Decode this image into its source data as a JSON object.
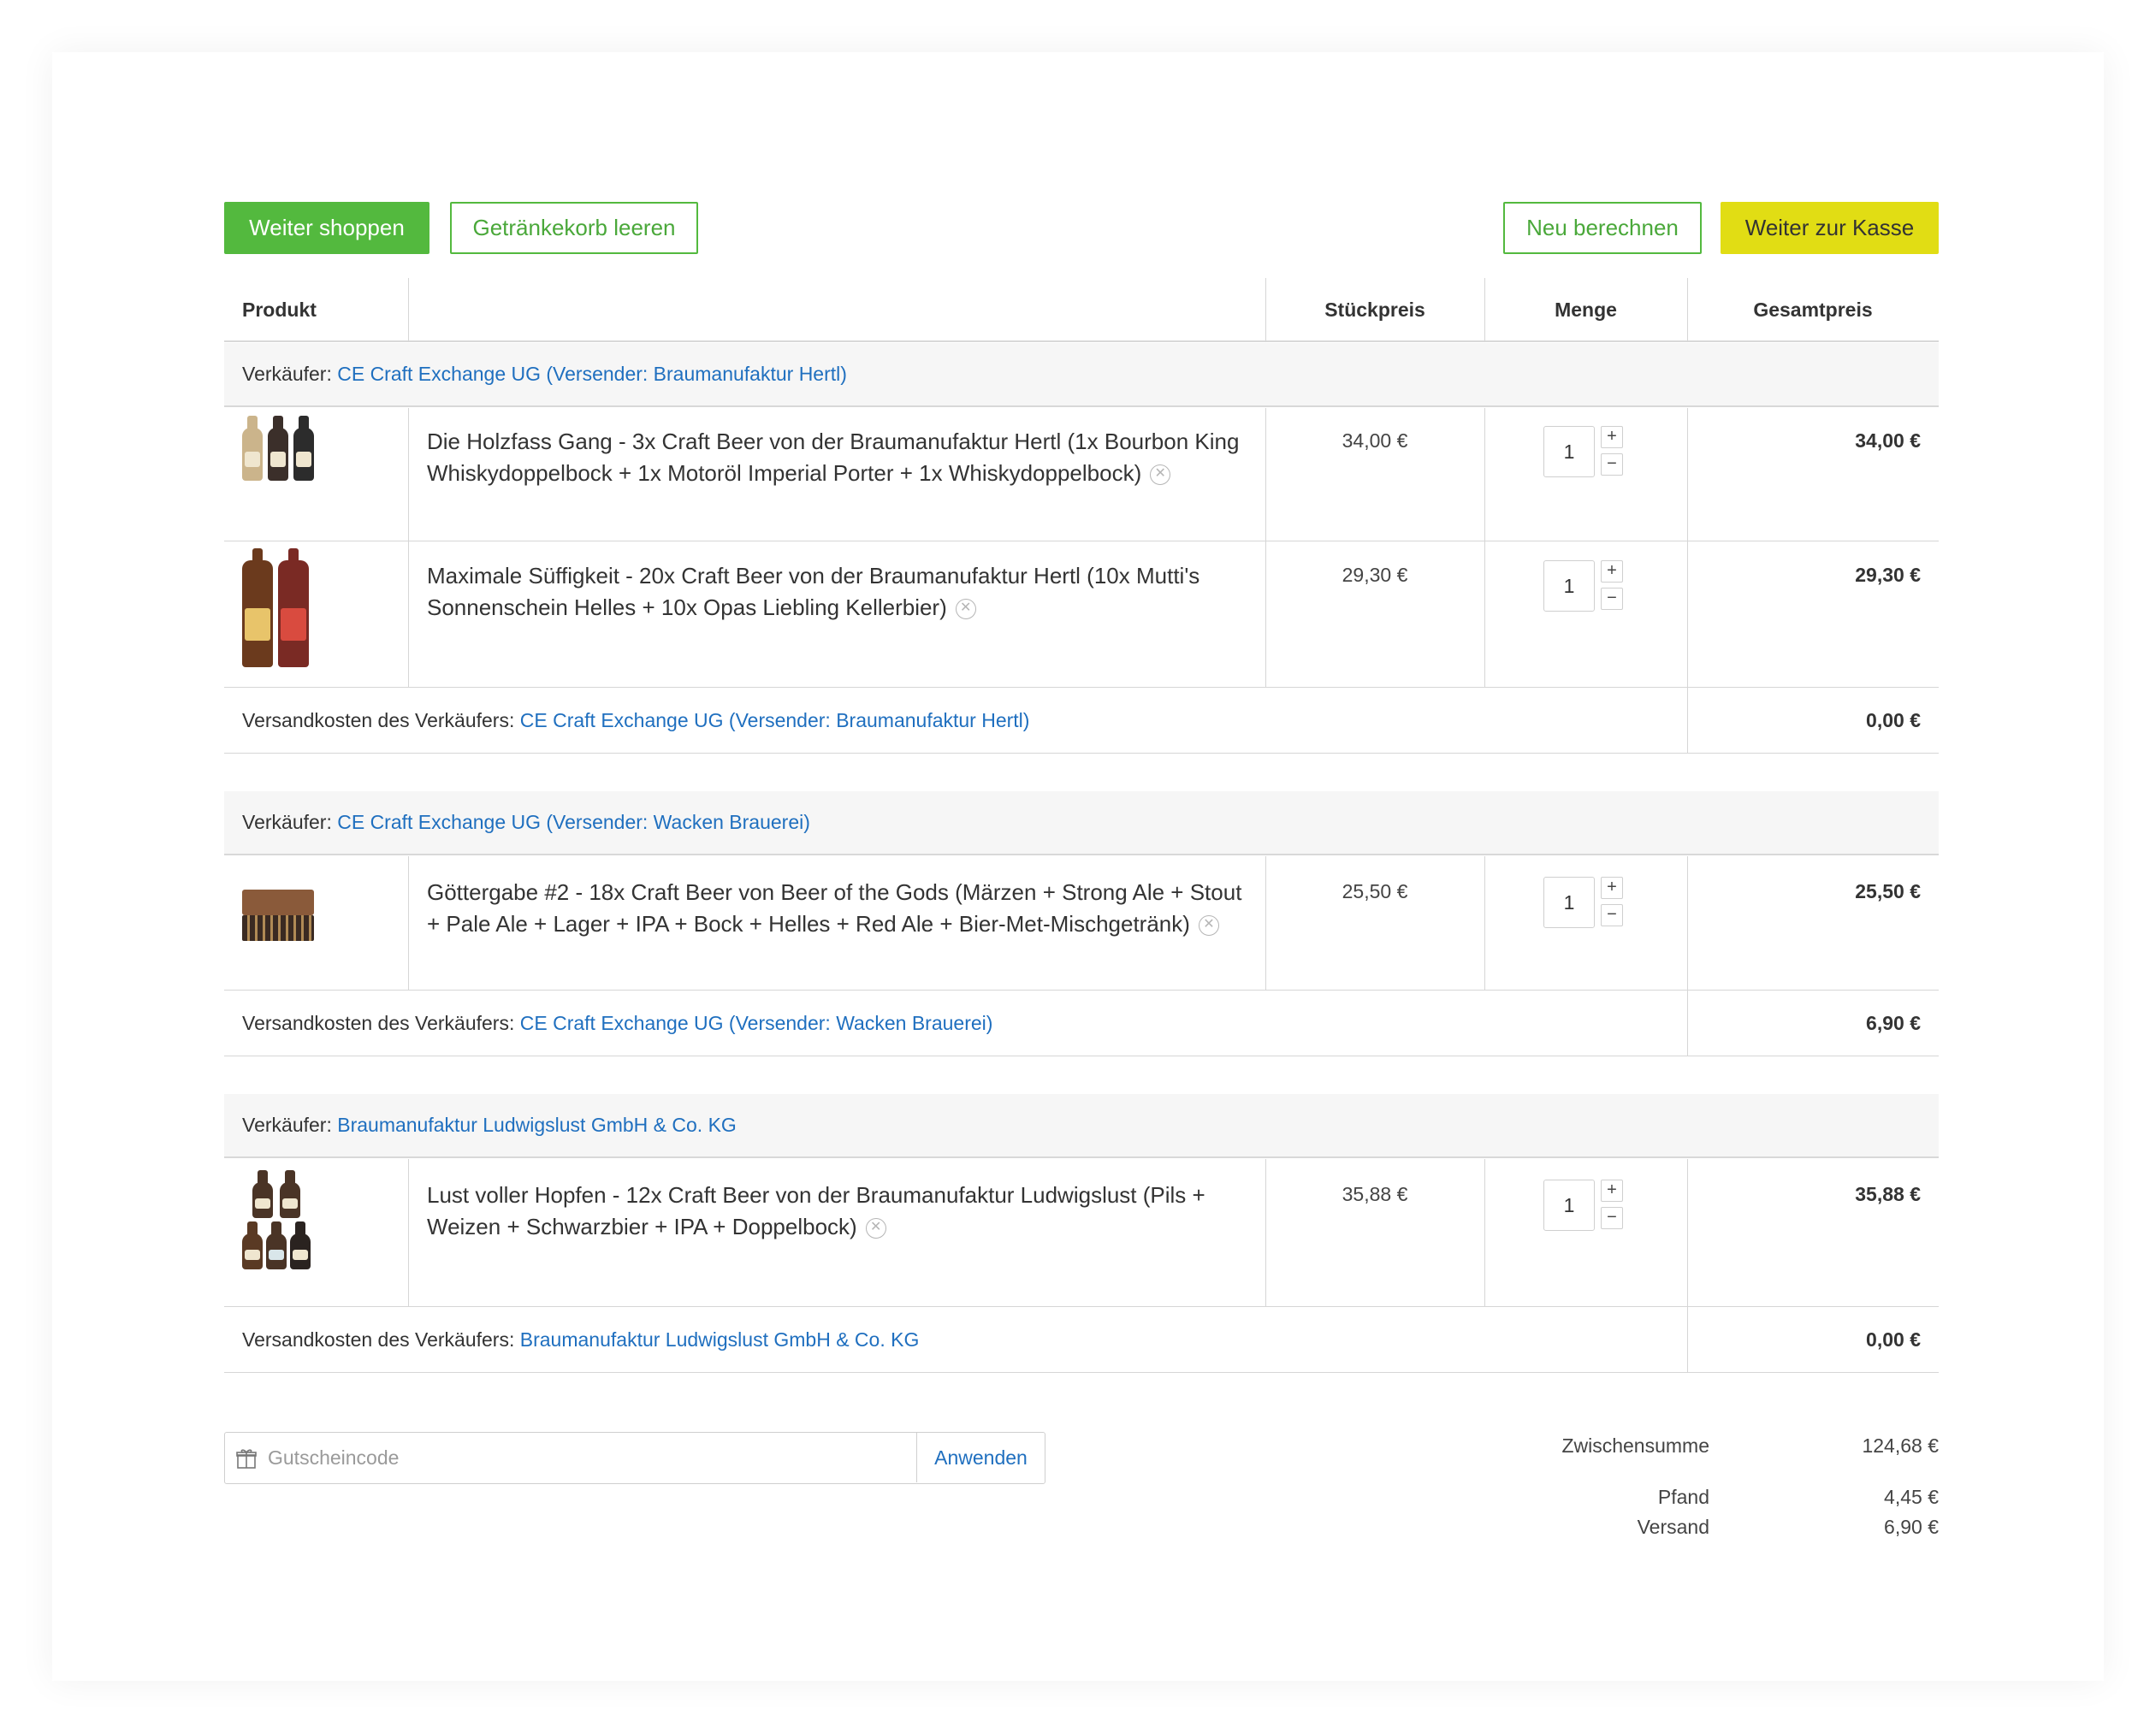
{
  "toolbar": {
    "continue_shopping": "Weiter shoppen",
    "empty_cart": "Getränkekorb leeren",
    "recalculate": "Neu berechnen",
    "checkout": "Weiter zur Kasse"
  },
  "table": {
    "headers": {
      "product": "Produkt",
      "unit_price": "Stückpreis",
      "quantity": "Menge",
      "total": "Gesamtpreis"
    }
  },
  "sellers": [
    {
      "prefix": "Verkäufer: ",
      "name": "CE Craft Exchange UG (Versender: Braumanufaktur Hertl)",
      "shipping_prefix": "Versandkosten des Verkäufers: ",
      "shipping_cost": "0,00 €",
      "items": [
        {
          "title": "Die Holzfass Gang - 3x Craft Beer von der Braumanufaktur Hertl (1x Bourbon King Whiskydoppelbock + 1x Motoröl Imperial Porter + 1x Whiskydoppelbock)",
          "unit_price": "34,00 €",
          "quantity": "1",
          "total": "34,00 €"
        },
        {
          "title": "Maximale Süffigkeit - 20x Craft Beer von der Braumanufaktur Hertl (10x Mutti's Sonnenschein Helles + 10x Opas Liebling Kellerbier)",
          "unit_price": "29,30 €",
          "quantity": "1",
          "total": "29,30 €"
        }
      ]
    },
    {
      "prefix": "Verkäufer: ",
      "name": "CE Craft Exchange UG (Versender: Wacken Brauerei)",
      "shipping_prefix": "Versandkosten des Verkäufers: ",
      "shipping_cost": "6,90 €",
      "items": [
        {
          "title": "Göttergabe #2 - 18x Craft Beer von Beer of the Gods (Märzen + Strong Ale + Stout + Pale Ale + Lager + IPA + Bock + Helles + Red Ale + Bier-Met-Mischgetränk)",
          "unit_price": "25,50 €",
          "quantity": "1",
          "total": "25,50 €"
        }
      ]
    },
    {
      "prefix": "Verkäufer: ",
      "name": "Braumanufaktur Ludwigslust GmbH & Co. KG",
      "shipping_prefix": "Versandkosten des Verkäufers: ",
      "shipping_cost": "0,00 €",
      "items": [
        {
          "title": "Lust voller Hopfen - 12x Craft Beer von der Braumanufaktur Ludwigslust (Pils + Weizen + Schwarzbier + IPA + Doppelbock)",
          "unit_price": "35,88 €",
          "quantity": "1",
          "total": "35,88 €"
        }
      ]
    }
  ],
  "coupon": {
    "placeholder": "Gutscheincode",
    "apply_label": "Anwenden"
  },
  "summary": {
    "subtotal_label": "Zwischensumme",
    "subtotal": "124,68 €",
    "deposit_label": "Pfand",
    "deposit": "4,45 €",
    "shipping_label": "Versand",
    "shipping": "6,90 €"
  },
  "colors": {
    "primary_green": "#53b93e",
    "checkout_yellow": "#e1dd14",
    "link_blue": "#1f6fbf"
  }
}
